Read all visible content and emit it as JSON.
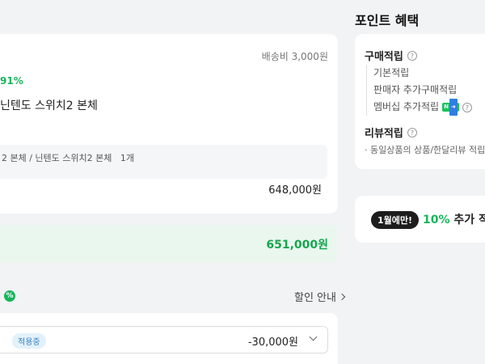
{
  "order": {
    "shipping_fee": "배송비 3,000원",
    "discount_rate": "91%",
    "product_name": "닌텐도 스위치2 본체",
    "option_text": "2 본체 / 닌텐도 스위치2 본체",
    "option_qty": "1개",
    "item_price": "648,000원"
  },
  "total": {
    "amount": "651,000원"
  },
  "coupon": {
    "badge": "%",
    "guide_label": "할인 안내",
    "applied_tag": "적용중",
    "amount": "-30,000원"
  },
  "points": {
    "title": "포인트 혜택",
    "purchase_heading": "구매적립",
    "purchase_items": [
      "기본적립",
      "판매자 추가구매적립",
      "멤버십 추가적립"
    ],
    "membership_badge": "N",
    "review_heading": "리뷰적립",
    "review_note": "· 동일상품의 상품/한달리뷰 적립"
  },
  "promo": {
    "pill": "1월에만!",
    "highlight": "10%",
    "text": "추가 적립"
  },
  "colors": {
    "accent_green": "#17b55c",
    "total_bg": "#eaf7ef",
    "page_bg": "#f2f3f5"
  }
}
